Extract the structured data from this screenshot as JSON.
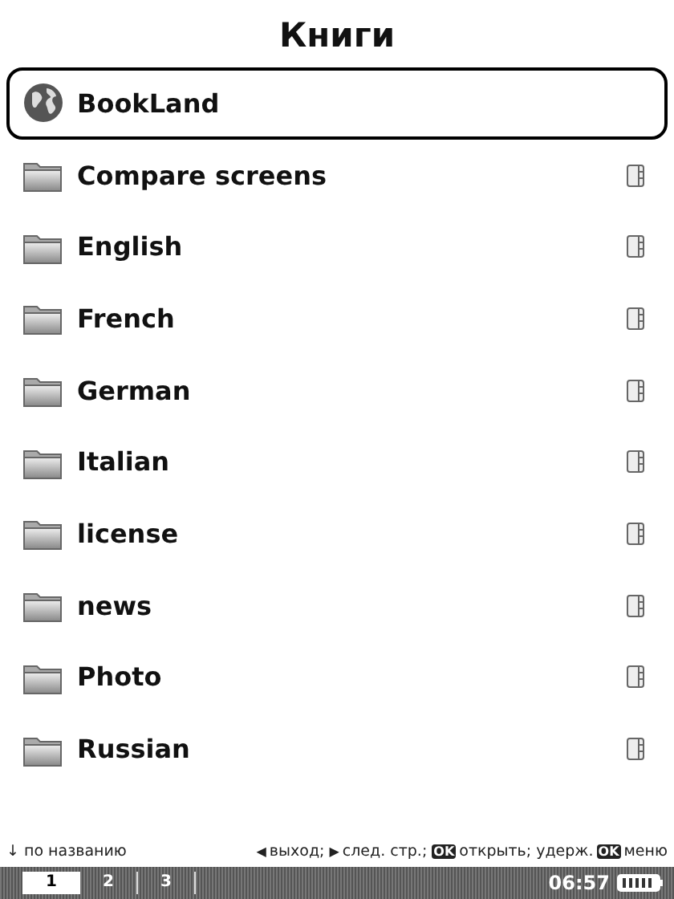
{
  "title": "Книги",
  "items": [
    {
      "label": "BookLand",
      "kind": "link",
      "selected": true
    },
    {
      "label": "Compare screens",
      "kind": "folder",
      "selected": false
    },
    {
      "label": "English",
      "kind": "folder",
      "selected": false
    },
    {
      "label": "French",
      "kind": "folder",
      "selected": false
    },
    {
      "label": "German",
      "kind": "folder",
      "selected": false
    },
    {
      "label": "Italian",
      "kind": "folder",
      "selected": false
    },
    {
      "label": "license",
      "kind": "folder",
      "selected": false
    },
    {
      "label": "news",
      "kind": "folder",
      "selected": false
    },
    {
      "label": "Photo",
      "kind": "folder",
      "selected": false
    },
    {
      "label": "Russian",
      "kind": "folder",
      "selected": false
    }
  ],
  "sort": {
    "icon": "↓",
    "label": "по названию"
  },
  "hints": [
    {
      "key": "◀",
      "kind": "glyph",
      "label": "выход;"
    },
    {
      "key": "▶",
      "kind": "glyph",
      "label": "след. стр.;"
    },
    {
      "key": "OK",
      "kind": "badge",
      "label": "открыть;"
    },
    {
      "prefix": "удерж.",
      "key": "OK",
      "kind": "badge",
      "label": "меню"
    }
  ],
  "pages": [
    {
      "label": "1",
      "selected": true
    },
    {
      "label": "2",
      "selected": false
    },
    {
      "label": "3",
      "selected": false
    }
  ],
  "time": "06:57"
}
